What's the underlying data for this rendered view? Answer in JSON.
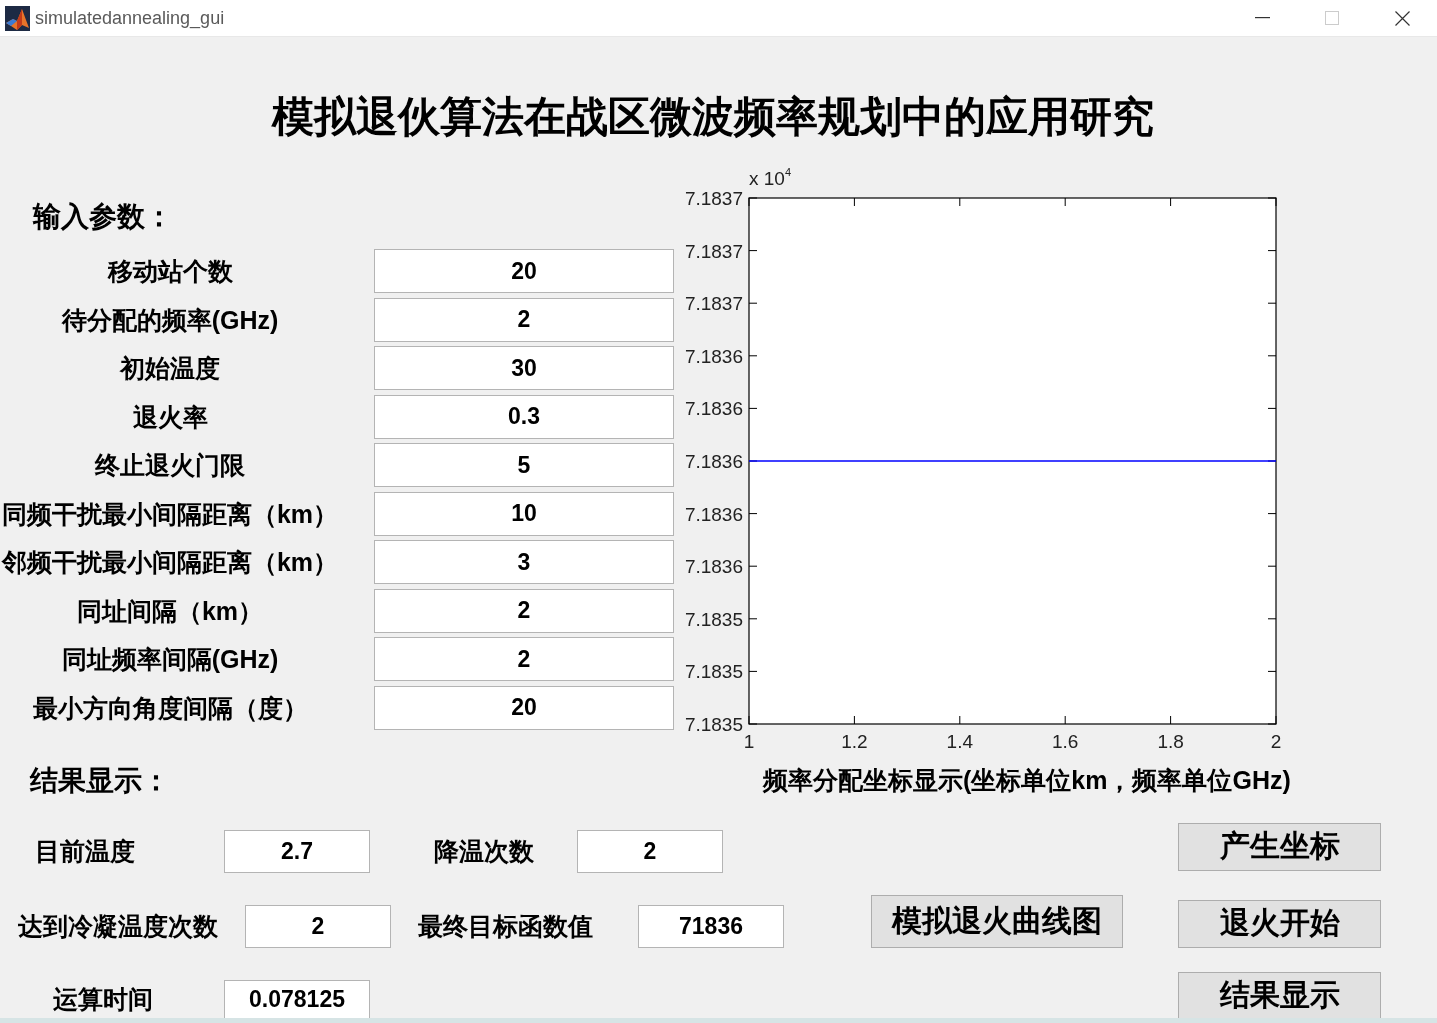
{
  "window": {
    "title": "simulatedannealing_gui",
    "maximize_disabled": true
  },
  "heading": "模拟退伙算法在战区微波频率规划中的应用研究",
  "inputs": {
    "title": "输入参数：",
    "fields": [
      {
        "label": "移动站个数",
        "value": "20"
      },
      {
        "label": "待分配的频率(GHz)",
        "value": "2"
      },
      {
        "label": "初始温度",
        "value": "30"
      },
      {
        "label": "退火率",
        "value": "0.3"
      },
      {
        "label": "终止退火门限",
        "value": "5"
      },
      {
        "label": "同频干扰最小间隔距离（km）",
        "value": "10"
      },
      {
        "label": "邻频干扰最小间隔距离（km）",
        "value": "3"
      },
      {
        "label": "同址间隔（km）",
        "value": "2"
      },
      {
        "label": "同址频率间隔(GHz)",
        "value": "2"
      },
      {
        "label": "最小方向角度间隔（度）",
        "value": "20"
      }
    ]
  },
  "plot": {
    "chart_data": [
      {
        "type": "line",
        "x": [
          1,
          2
        ],
        "values": [
          7.1836,
          7.1836
        ],
        "color": "#0000ff",
        "xlim": [
          1,
          2
        ],
        "ylim": [
          7.1835,
          7.1837
        ],
        "xticks": [
          1,
          1.2,
          1.4,
          1.6,
          1.8,
          2
        ],
        "yticks": [
          {
            "value": 7.1835,
            "label": "7.1835"
          },
          {
            "value": 7.18352,
            "label": "7.1835"
          },
          {
            "value": 7.18354,
            "label": "7.1835"
          },
          {
            "value": 7.18356,
            "label": "7.1836"
          },
          {
            "value": 7.18358,
            "label": "7.1836"
          },
          {
            "value": 7.1836,
            "label": "7.1836"
          },
          {
            "value": 7.18362,
            "label": "7.1836"
          },
          {
            "value": 7.18364,
            "label": "7.1836"
          },
          {
            "value": 7.18366,
            "label": "7.1837"
          },
          {
            "value": 7.18368,
            "label": "7.1837"
          },
          {
            "value": 7.1837,
            "label": "7.1837"
          }
        ],
        "annotations": [
          "x 10$^{4}$"
        ],
        "xlabel": "频率分配坐标显示(坐标单位km，频率单位GHz)"
      }
    ]
  },
  "results": {
    "title": "结果显示：",
    "rows": [
      [
        {
          "label": "目前温度",
          "value": "2.7"
        },
        {
          "label": "降温次数",
          "value": "2"
        }
      ],
      [
        {
          "label": "达到冷凝温度次数",
          "value": "2"
        },
        {
          "label": "最终目标函数值",
          "value": "71836"
        }
      ],
      [
        {
          "label": "运算时间",
          "value": "0.078125"
        }
      ]
    ]
  },
  "buttons": [
    "产生坐标",
    "模拟退火曲线图",
    "退火开始",
    "结果显示"
  ]
}
